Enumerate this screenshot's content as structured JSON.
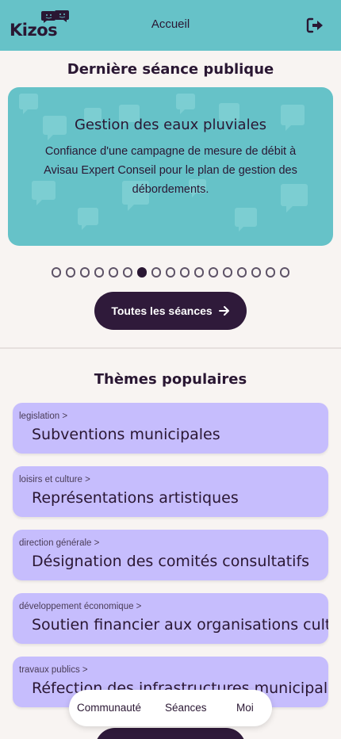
{
  "colors": {
    "header_bg": "#66c2c8",
    "page_bg": "#f8f4f2",
    "dark": "#2f1a3a",
    "theme_card_bg": "#c6bdfd",
    "text": "#2a1733"
  },
  "header": {
    "logo_text": "Kizos",
    "title": "Accueil",
    "logout_icon": "logout-icon"
  },
  "last_session": {
    "heading": "Dernière séance publique",
    "card_title": "Gestion des eaux pluviales",
    "card_description": "Confiance d'une campagne de mesure de débit à Avisau Expert Conseil pour le plan de gestion des débordements.",
    "carousel_total": 17,
    "carousel_active_index": 6,
    "all_sessions_label": "Toutes les séances"
  },
  "popular": {
    "heading": "Thèmes populaires",
    "themes": [
      {
        "category": "legislation >",
        "name": "Subventions municipales"
      },
      {
        "category": "loisirs et culture >",
        "name": "Représentations artistiques"
      },
      {
        "category": "direction générale >",
        "name": "Désignation des comités consultatifs"
      },
      {
        "category": "développement économique >",
        "name": "Soutien financier aux organisations culturelles"
      },
      {
        "category": "travaux publics >",
        "name": "Réfection des infrastructures municipales"
      }
    ]
  },
  "bottom_nav": {
    "items": [
      "Communauté",
      "Séances",
      "Moi"
    ]
  }
}
